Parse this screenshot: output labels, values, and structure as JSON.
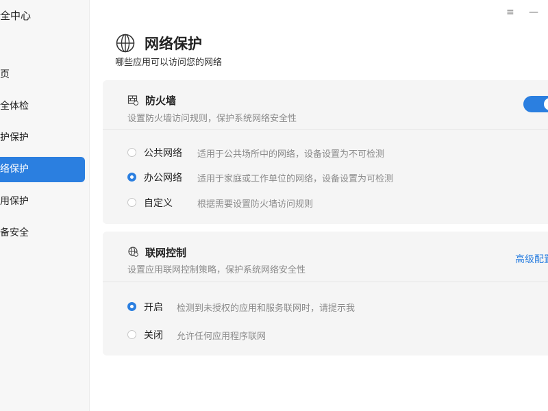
{
  "sidebar": {
    "app_title": "全中心",
    "items": [
      {
        "label": "页",
        "active": false
      },
      {
        "label": "全体检",
        "active": false
      },
      {
        "label": "护保护",
        "active": false
      },
      {
        "label": "络保护",
        "active": true
      },
      {
        "label": "用保护",
        "active": false
      },
      {
        "label": "备安全",
        "active": false
      }
    ]
  },
  "window": {
    "menu_icon": "≡",
    "minimize_icon": "—"
  },
  "header": {
    "icon": "globe-icon",
    "title": "网络保护",
    "subtitle": "哪些应用可以访问您的网络"
  },
  "firewall": {
    "icon": "firewall-icon",
    "title": "防火墙",
    "description": "设置防火墙访问规则，保护系统网络安全性",
    "enabled": true,
    "options": [
      {
        "label": "公共网络",
        "description": "适用于公共场所中的网络，设备设置为不可检测",
        "checked": false
      },
      {
        "label": "办公网络",
        "description": "适用于家庭或工作单位的网络，设备设置为可检测",
        "checked": true
      },
      {
        "label": "自定义",
        "description": "根据需要设置防火墙访问规则",
        "checked": false
      }
    ]
  },
  "network_control": {
    "icon": "network-control-icon",
    "title": "联网控制",
    "description": "设置应用联网控制策略，保护系统网络安全性",
    "advanced_link": "高级配置",
    "options": [
      {
        "label": "开启",
        "description": "检测到未授权的应用和服务联网时，请提示我",
        "checked": true
      },
      {
        "label": "关闭",
        "description": "允许任何应用程序联网",
        "checked": false
      }
    ]
  },
  "colors": {
    "accent": "#2b7fe0",
    "card_bg": "#f5f5f5",
    "sidebar_bg": "#f7f7f7",
    "muted_text": "#8a8a8a"
  }
}
